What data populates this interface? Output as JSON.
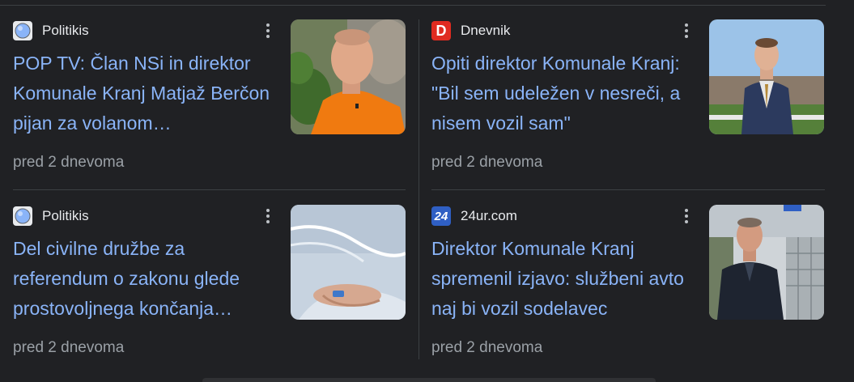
{
  "articles": [
    {
      "source": "Politikis",
      "source_icon": "globe-icon",
      "title": "POP TV: Član NSi in direktor Komunale Kranj Matjaž Berčon pijan za volanom…",
      "time": "pred 2 dnevoma",
      "thumbnail": "man-in-orange-shirt-photo"
    },
    {
      "source": "Dnevnik",
      "source_icon": "dnevnik-logo-icon",
      "source_icon_text": "D",
      "title": "Opiti direktor Komunale Kranj: \"Bil sem udeležen v nesreči, a nisem vozil sam\"",
      "time": "pred 2 dnevoma",
      "thumbnail": "man-in-suit-photo"
    },
    {
      "source": "Politikis",
      "source_icon": "globe-icon",
      "title": "Del civilne družbe za referendum o zakonu glede prostovoljnega končanja…",
      "time": "pred 2 dnevoma",
      "thumbnail": "hospital-patient-hand-photo"
    },
    {
      "source": "24ur.com",
      "source_icon": "24ur-logo-icon",
      "source_icon_text": "24",
      "title": "Direktor Komunale Kranj spremenil izjavo: službeni avto naj bi vozil sodelavec",
      "time": "pred 2 dnevoma",
      "thumbnail": "man-in-dark-jacket-photo"
    }
  ],
  "colors": {
    "background": "#202124",
    "title_link": "#8ab4f8",
    "source_text": "#e8eaed",
    "meta_text": "#9aa0a6",
    "divider": "#3c4043",
    "dnevnik_red": "#e02b20",
    "ur24_blue": "#2f5fc4"
  }
}
